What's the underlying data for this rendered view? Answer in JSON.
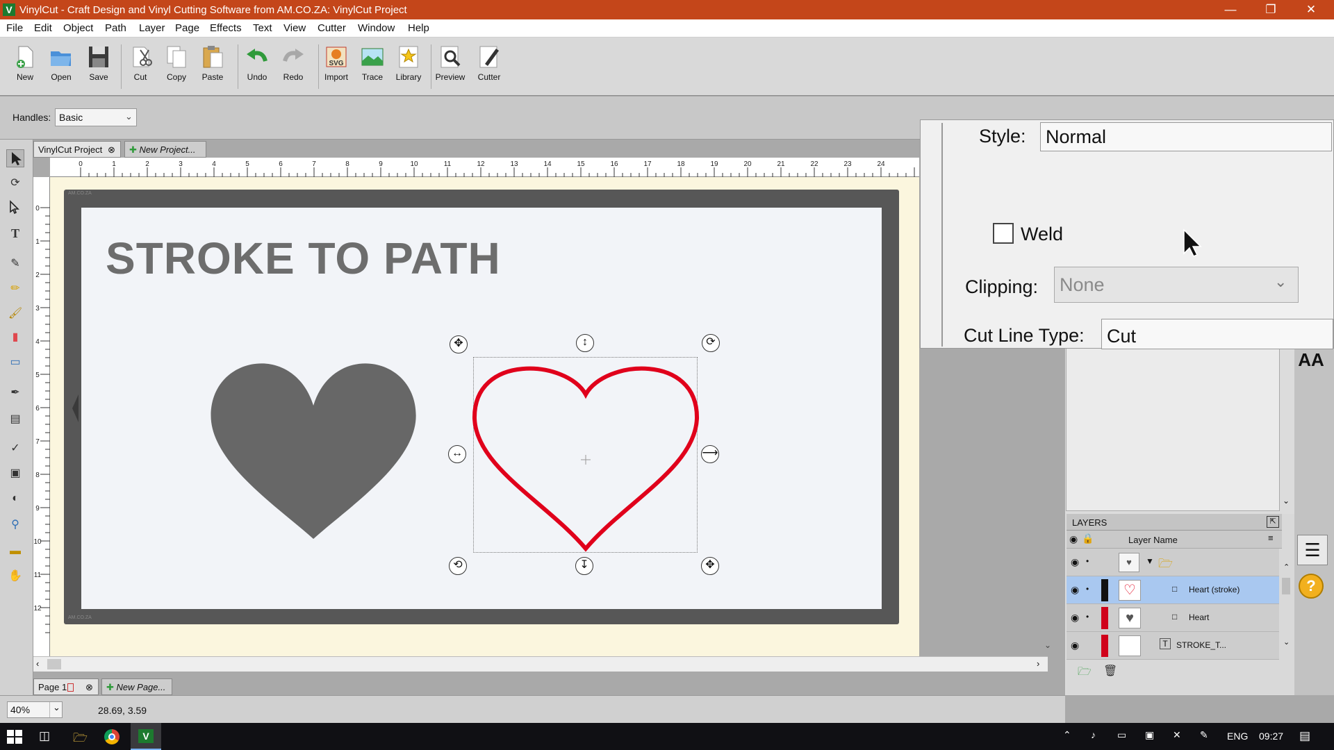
{
  "window": {
    "title": "VinylCut - Craft Design and Vinyl Cutting Software from AM.CO.ZA: VinylCut Project",
    "app_icon": "V"
  },
  "menu": [
    "File",
    "Edit",
    "Object",
    "Path",
    "Layer",
    "Page",
    "Effects",
    "Text",
    "View",
    "Cutter",
    "Window",
    "Help"
  ],
  "toolbar": {
    "new": "New",
    "open": "Open",
    "save": "Save",
    "cut": "Cut",
    "copy": "Copy",
    "paste": "Paste",
    "undo": "Undo",
    "redo": "Redo",
    "import": "Import",
    "import_badge": "SVG",
    "trace": "Trace",
    "library": "Library",
    "preview": "Preview",
    "cutter": "Cutter"
  },
  "props": {
    "handles_label": "Handles:",
    "handles_value": "Basic"
  },
  "doc_tabs": {
    "active": "VinylCut Project",
    "new": "New Project..."
  },
  "ruler": {
    "h": [
      "0",
      "1",
      "2",
      "3",
      "4",
      "5",
      "6",
      "7",
      "8",
      "9",
      "10",
      "11",
      "12",
      "13",
      "14",
      "15",
      "16",
      "17",
      "18",
      "19",
      "20",
      "21",
      "22",
      "23",
      "24"
    ],
    "v": [
      "0",
      "1",
      "2",
      "3",
      "4",
      "5",
      "6",
      "7",
      "8",
      "9",
      "10",
      "11",
      "12"
    ]
  },
  "canvas": {
    "title_text": "STROKE TO PATH",
    "mat_mark": "AM.CO.ZA"
  },
  "page_tabs": {
    "active": "Page 1",
    "new": "New Page..."
  },
  "status": {
    "zoom": "40%",
    "coords": "28.69, 3.59"
  },
  "popup": {
    "style_label": "Style:",
    "style_value": "Normal",
    "weld_label": "Weld",
    "clipping_label": "Clipping:",
    "clipping_value": "None",
    "cutline_label": "Cut Line Type:",
    "cutline_value": "Cut"
  },
  "side_icons": {
    "text_style": "AA",
    "help": "?"
  },
  "layers": {
    "title": "LAYERS",
    "column": "Layer Name",
    "items": [
      {
        "name": "",
        "selected": false,
        "color": "#cdcdcd"
      },
      {
        "name": "Heart (stroke)",
        "selected": true,
        "color": "#111111"
      },
      {
        "name": "Heart",
        "selected": false,
        "color": "#d0021b"
      },
      {
        "name": "STROKE_T...",
        "selected": false,
        "color": "#d0021b"
      }
    ]
  },
  "taskbar": {
    "lang": "ENG",
    "time": "09:27"
  },
  "colors": {
    "title_bar": "#c4461a",
    "stroke_heart": "#e0001b",
    "fill_heart": "#676767",
    "selected_row": "#a9c8f0"
  }
}
